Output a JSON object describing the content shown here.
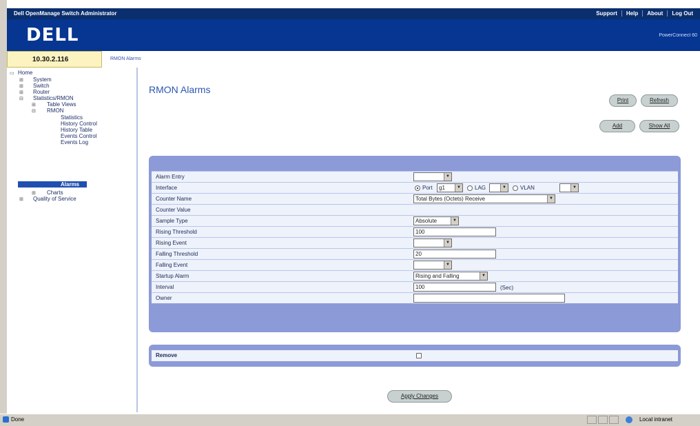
{
  "window": {
    "title": "Dell OpenManage Switch Administrator",
    "top_links": [
      "Support",
      "Help",
      "About",
      "Log Out"
    ]
  },
  "brand": {
    "logo_text": "DELL",
    "product_text": "PowerConnect 60"
  },
  "ip_address": "10.30.2.116",
  "breadcrumb": "RMON Alarms",
  "sidebar": {
    "items": [
      {
        "label": "Home"
      },
      {
        "label": "System"
      },
      {
        "label": "Switch"
      },
      {
        "label": "Router"
      },
      {
        "label": "Statistics/RMON"
      },
      {
        "label": "Table Views"
      },
      {
        "label": "RMON"
      },
      {
        "label": "Statistics"
      },
      {
        "label": "History Control"
      },
      {
        "label": "History Table"
      },
      {
        "label": "Events Control"
      },
      {
        "label": "Events Log"
      },
      {
        "label": "Alarms"
      },
      {
        "label": "Charts"
      },
      {
        "label": "Quality of Service"
      }
    ]
  },
  "page": {
    "title": "RMON Alarms",
    "buttons": {
      "print": "Print",
      "refresh": "Refresh",
      "add": "Add",
      "show_all": "Show All",
      "apply": "Apply Changes"
    }
  },
  "form": {
    "alarm_entry": {
      "label": "Alarm Entry",
      "value": ""
    },
    "interface": {
      "label": "Interface",
      "port_label": "Port",
      "port_value": "g1",
      "lag_label": "LAG",
      "lag_value": "",
      "vlan_label": "VLAN",
      "vlan_value": ""
    },
    "counter_name": {
      "label": "Counter Name",
      "value": "Total Bytes (Octets) Receive"
    },
    "counter_value": {
      "label": "Counter Value",
      "value": ""
    },
    "sample_type": {
      "label": "Sample Type",
      "value": "Absolute"
    },
    "rising_threshold": {
      "label": "Rising Threshold",
      "value": "100"
    },
    "rising_event": {
      "label": "Rising Event",
      "value": ""
    },
    "falling_threshold": {
      "label": "Falling Threshold",
      "value": "20"
    },
    "falling_event": {
      "label": "Falling Event",
      "value": ""
    },
    "startup_alarm": {
      "label": "Startup Alarm",
      "value": "Rising and Falling"
    },
    "interval": {
      "label": "Interval",
      "value": "100",
      "unit": "(Sec)"
    },
    "owner": {
      "label": "Owner",
      "value": ""
    }
  },
  "remove": {
    "label": "Remove"
  },
  "statusbar": {
    "left": "Done",
    "right": "Local intranet"
  }
}
